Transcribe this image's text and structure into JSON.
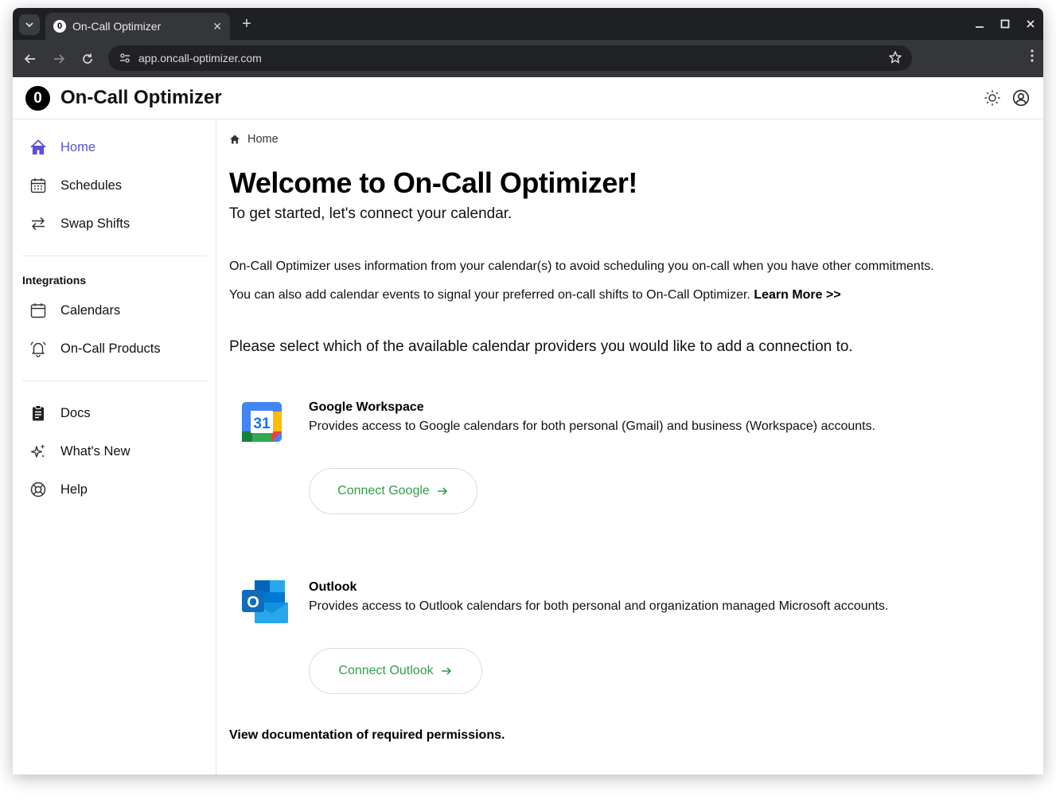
{
  "browser": {
    "tab_favicon": "0",
    "tab_title": "On-Call Optimizer",
    "url": "app.oncall-optimizer.com"
  },
  "app": {
    "logo_letter": "0",
    "title": "On-Call Optimizer"
  },
  "sidebar": {
    "primary": [
      {
        "label": "Home",
        "icon": "home-icon",
        "active": true
      },
      {
        "label": "Schedules",
        "icon": "calendar-grid-icon"
      },
      {
        "label": "Swap Shifts",
        "icon": "swap-arrows-icon"
      }
    ],
    "integrations_heading": "Integrations",
    "integrations": [
      {
        "label": "Calendars",
        "icon": "calendar-icon"
      },
      {
        "label": "On-Call Products",
        "icon": "bell-icon"
      }
    ],
    "secondary": [
      {
        "label": "Docs",
        "icon": "clipboard-icon"
      },
      {
        "label": "What's New",
        "icon": "sparkles-icon"
      },
      {
        "label": "Help",
        "icon": "lifebuoy-icon"
      }
    ]
  },
  "breadcrumb": {
    "label": "Home"
  },
  "main": {
    "heading": "Welcome to On-Call Optimizer!",
    "subheading": "To get started, let's connect your calendar.",
    "intro": "On-Call Optimizer uses information from your calendar(s) to avoid scheduling you on-call when you have other commitments.",
    "intro2": "You can also add calendar events to signal your preferred on-call shifts to On-Call Optimizer.",
    "learn_more": "Learn More >>",
    "prompt": "Please select which of the available calendar providers you would like to add a connection to.",
    "providers": [
      {
        "name": "Google Workspace",
        "description": "Provides access to Google calendars for both personal (Gmail) and business (Workspace) accounts.",
        "button": "Connect Google",
        "logo_text": "31"
      },
      {
        "name": "Outlook",
        "description": "Provides access to Outlook calendars for both personal and organization managed Microsoft accounts.",
        "button": "Connect Outlook",
        "logo_text": "O"
      }
    ],
    "permissions_link": "View documentation of required permissions."
  },
  "colors": {
    "accent": "#5a4fd6",
    "connect_text": "#2f9e4d"
  }
}
